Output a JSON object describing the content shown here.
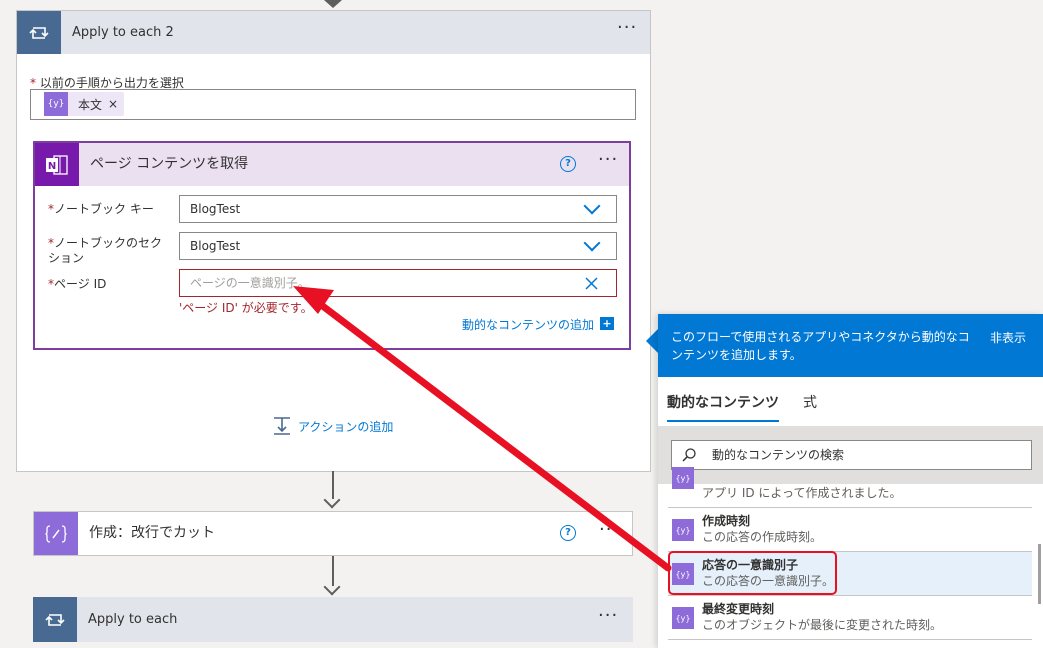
{
  "apply_each_2": {
    "title": "Apply to each 2",
    "more": "···",
    "field_required": "*",
    "field_label": "以前の手順から出力を選択",
    "token_icon": "{y}",
    "token_label": "本文",
    "token_remove": "×"
  },
  "onenote": {
    "title": "ページ コンテンツを取得",
    "help": "?",
    "more": "···",
    "fields": [
      {
        "required": "*",
        "label": "ノートブック キー",
        "value": "BlogTest"
      },
      {
        "required": "*",
        "label": "ノートブックのセクション",
        "value": "BlogTest"
      },
      {
        "required": "*",
        "label": "ページ ID",
        "placeholder": "ページの一意識別子。"
      }
    ],
    "error": "'ページ ID' が必要です。",
    "add_dynamic": "動的なコンテンツの追加",
    "add_dynamic_icon": "+"
  },
  "add_action": "アクションの追加",
  "compose": {
    "title": "作成：改行でカット",
    "help": "?",
    "more": "···"
  },
  "apply_each": {
    "title": "Apply to each",
    "more": "···"
  },
  "panel": {
    "header_text": "このフローで使用されるアプリやコネクタから動的なコンテンツを追加します。",
    "hide": "非表示",
    "tabs": [
      "動的なコンテンツ",
      "式"
    ],
    "search_placeholder": "動的なコンテンツの検索",
    "items": [
      {
        "title": "",
        "desc": "アプリ ID によって作成されました。",
        "icon": "{y}"
      },
      {
        "title": "作成時刻",
        "desc": "この応答の作成時刻。",
        "icon": "{y}"
      },
      {
        "title": "応答の一意識別子",
        "desc": "この応答の一意識別子。",
        "icon": "{y}"
      },
      {
        "title": "最終変更時刻",
        "desc": "このオブジェクトが最後に変更された時刻。",
        "icon": "{y}"
      }
    ]
  },
  "colors": {
    "accent": "#0078d4",
    "onenote": "#7719aa",
    "loop": "#486991",
    "compose": "#8d6bd9",
    "error": "#a4262c",
    "annotation": "#ff0000"
  }
}
